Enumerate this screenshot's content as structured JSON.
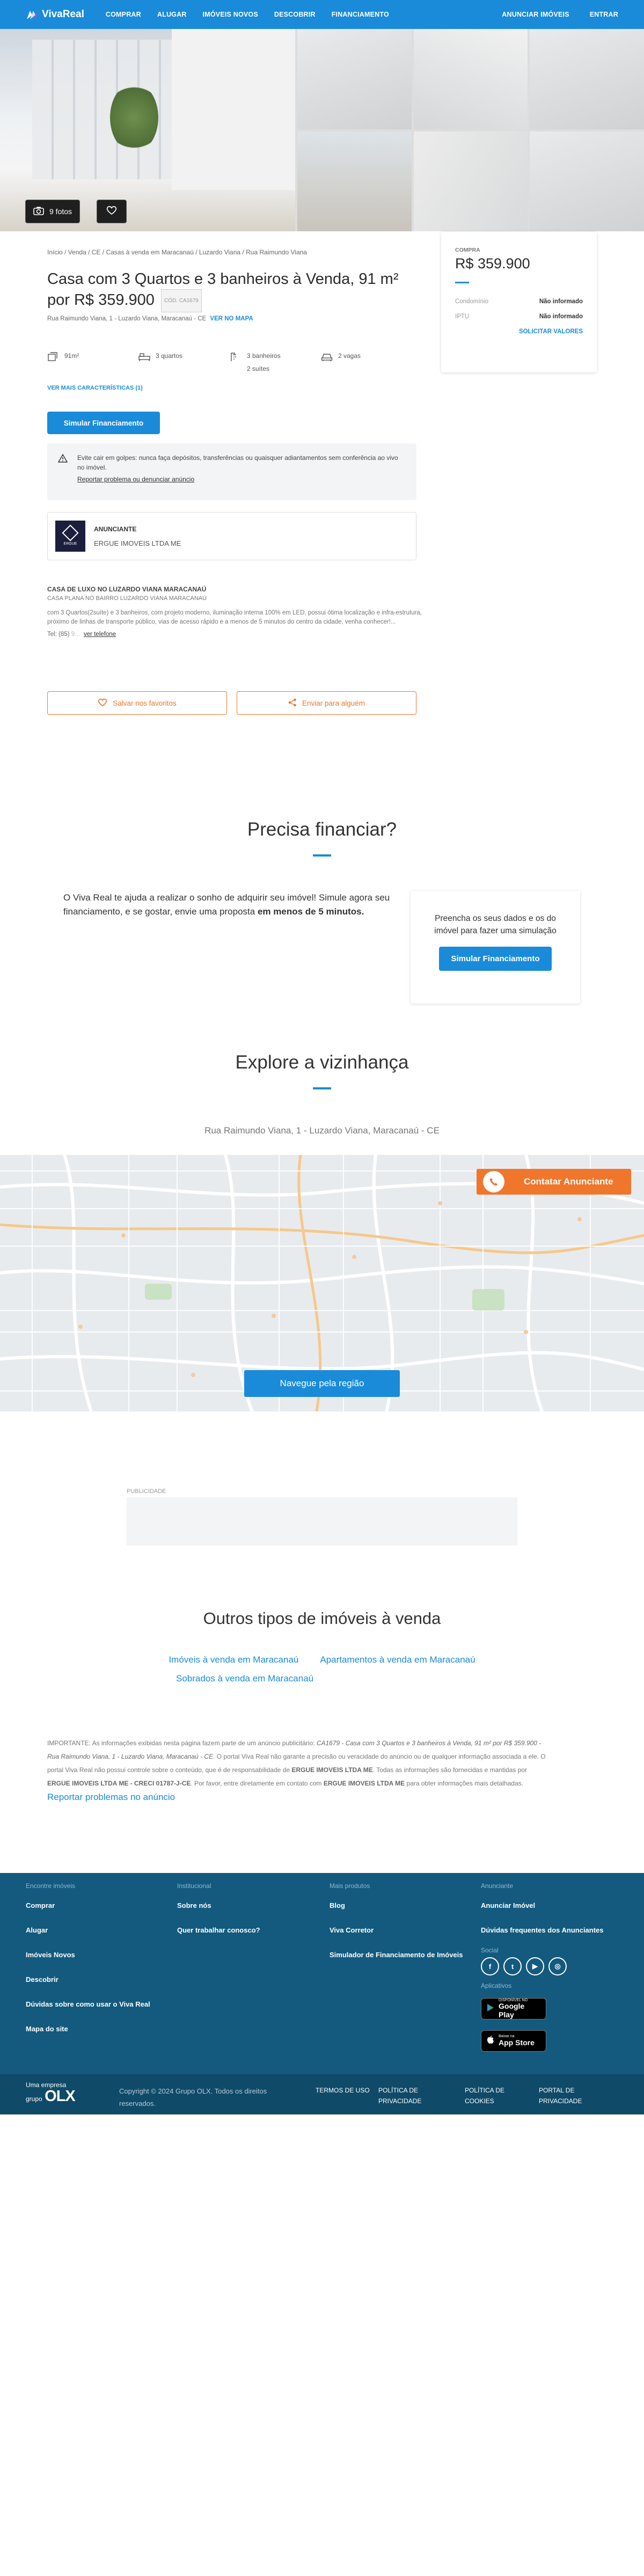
{
  "header": {
    "logo": "VivaReal",
    "nav_left": [
      "COMPRAR",
      "ALUGAR",
      "IMÓVEIS NOVOS",
      "DESCOBRIR",
      "FINANCIAMENTO"
    ],
    "nav_right": [
      "ANUNCIAR IMÓVEIS",
      "ENTRAR"
    ]
  },
  "gallery": {
    "photos_label": "9 fotos"
  },
  "breadcrumb": [
    "Início",
    "Venda",
    "CE",
    "Casas à venda em Maracanaú",
    "Luzardo Viana",
    "Rua Raimundo Viana"
  ],
  "listing": {
    "title": "Casa com 3 Quartos e 3 banheiros à Venda, 91 m² por R$ 359.900",
    "code": "CÓD. CA1679",
    "address": "Rua Raimundo Viana, 1 - Luzardo Viana, Maracanaú - CE",
    "map_link": "VER NO MAPA",
    "features": [
      {
        "icon": "area-icon",
        "label": "91m²",
        "sub": ""
      },
      {
        "icon": "bed-icon",
        "label": "3 quartos",
        "sub": ""
      },
      {
        "icon": "bath-icon",
        "label": "3 banheiros",
        "sub": "2 suítes"
      },
      {
        "icon": "car-icon",
        "label": "2 vagas",
        "sub": ""
      }
    ],
    "more_features": "VER MAIS CARACTERÍSTICAS (1)",
    "financing_button": "Simular Financiamento",
    "warning": "Evite cair em golpes: nunca faça depósitos, transferências ou quaisquer adiantamentos sem conferência ao vivo no imóvel.",
    "report_link": "Reportar problema ou denunciar anúncio",
    "advertiser_role": "ANUNCIANTE",
    "advertiser_name": "ERGUE IMOVEIS LTDA ME",
    "advertiser_logo_text": "ERGUE",
    "desc_title": "CASA DE LUXO NO LUZARDO VIANA MARACANAÚ",
    "desc_subtitle": "CASA PLANA NO BAIRRO LUZARDO VIANA MARACANAÚ",
    "desc_body": "com 3 Quartos(2suíte) e 3 banheiros, com projeto moderno, iluminação interna 100% em LED, possui ótima localização e infra-estrutura, próximo de linhas de transporte público, vias de acesso rápido e a menos de 5 minutos do centro da cidade, venha conhecer!...",
    "tel_label": "Tel: (85)",
    "tel_masked": "9...",
    "tel_link": "ver telefone",
    "save_button": "Salvar nos favoritos",
    "share_button": "Enviar para alguém"
  },
  "price_card": {
    "label": "COMPRA",
    "price": "R$ 359.900",
    "rows": [
      {
        "label": "Condomínio",
        "value": "Não informado"
      },
      {
        "label": "IPTU",
        "value": "Não informado"
      }
    ],
    "link": "SOLICITAR VALORES"
  },
  "financing": {
    "title": "Precisa financiar?",
    "text": "O Viva Real te ajuda a realizar o sonho de adquirir seu imóvel! Simule agora seu financiamento, e se gostar, envie uma proposta ",
    "text_bold": "em menos de 5 minutos.",
    "card_text": "Preencha os seus dados e os do imóvel para fazer uma simulação",
    "card_button": "Simular Financiamento"
  },
  "neighborhood": {
    "title": "Explore a vizinhança",
    "address": "Rua Raimundo Viana, 1 - Luzardo Viana, Maracanaú - CE",
    "contact_button": "Contatar Anunciante",
    "nav_button": "Navegue pela região"
  },
  "ad": {
    "label": "PUBLICIDADE"
  },
  "others": {
    "title": "Outros tipos de imóveis à venda",
    "links_row1": [
      "Imóveis à venda em Maracanaú",
      "Apartamentos à venda em Maracanaú"
    ],
    "links_row2": [
      "Sobrados à venda em Maracanaú"
    ]
  },
  "disclaimer": {
    "p1": "IMPORTANTE: As informações exibidas nesta página fazem parte de um anúncio publicitário: ",
    "p1_italic": "CA1679 - Casa com 3 Quartos e 3 banheiros à Venda, 91 m² por R$ 359.900 - Rua Raimundo Viana, 1 - Luzardo Viana, Maracanaú - CE",
    "p2": ". O portal Viva Real não garante a precisão ou veracidade do anúncio ou de qualquer informação associada a ele. O portal Viva Real não possui controle sobre o conteúdo, que é de responsabilidade de ",
    "p2_bold": "ERGUE IMOVEIS LTDA ME",
    "p3": ". Todas as informações são fornecidas e mantidas por ",
    "p3_bold": "ERGUE IMOVEIS LTDA ME - CRECI 01787-J-CE",
    "p4": ". Por favor, entre diretamente em contato com ",
    "p4_bold": "ERGUE IMOVEIS LTDA ME",
    "p5": " para obter informações mais detalhadas. ",
    "report_link": "Reportar problemas no anúncio"
  },
  "footer": {
    "col1": {
      "heading": "Encontre imóveis",
      "items": [
        "Comprar",
        "Alugar",
        "Imóveis Novos",
        "Descobrir",
        "Dúvidas sobre como usar o Viva Real",
        "Mapa do site"
      ]
    },
    "col2": {
      "heading": "Institucional",
      "items": [
        "Sobre nós",
        "Quer trabalhar conosco?"
      ]
    },
    "col3": {
      "heading": "Mais produtos",
      "items": [
        "Blog",
        "Viva Corretor",
        "Simulador de Financiamento de Imóveis"
      ]
    },
    "col4": {
      "heading": "Anunciante",
      "items": [
        "Anunciar Imóvel",
        "Dúvidas frequentes dos Anunciantes"
      ]
    },
    "social_label": "Social",
    "apps_label": "Aplicativos",
    "google_play_top": "DISPONÍVEL NO",
    "google_play": "Google Play",
    "app_store_top": "Baixar na",
    "app_store": "App Store",
    "brand_small": "Uma empresa",
    "brand_group": "grupo",
    "brand_big": "OLX",
    "copyright": "Copyright © 2024 Grupo OLX. Todos os direitos reservados.",
    "legal": [
      "TERMOS DE USO",
      "POLÍTICA DE PRIVACIDADE",
      "POLÍTICA DE COOKIES",
      "PORTAL DE PRIVACIDADE"
    ]
  }
}
